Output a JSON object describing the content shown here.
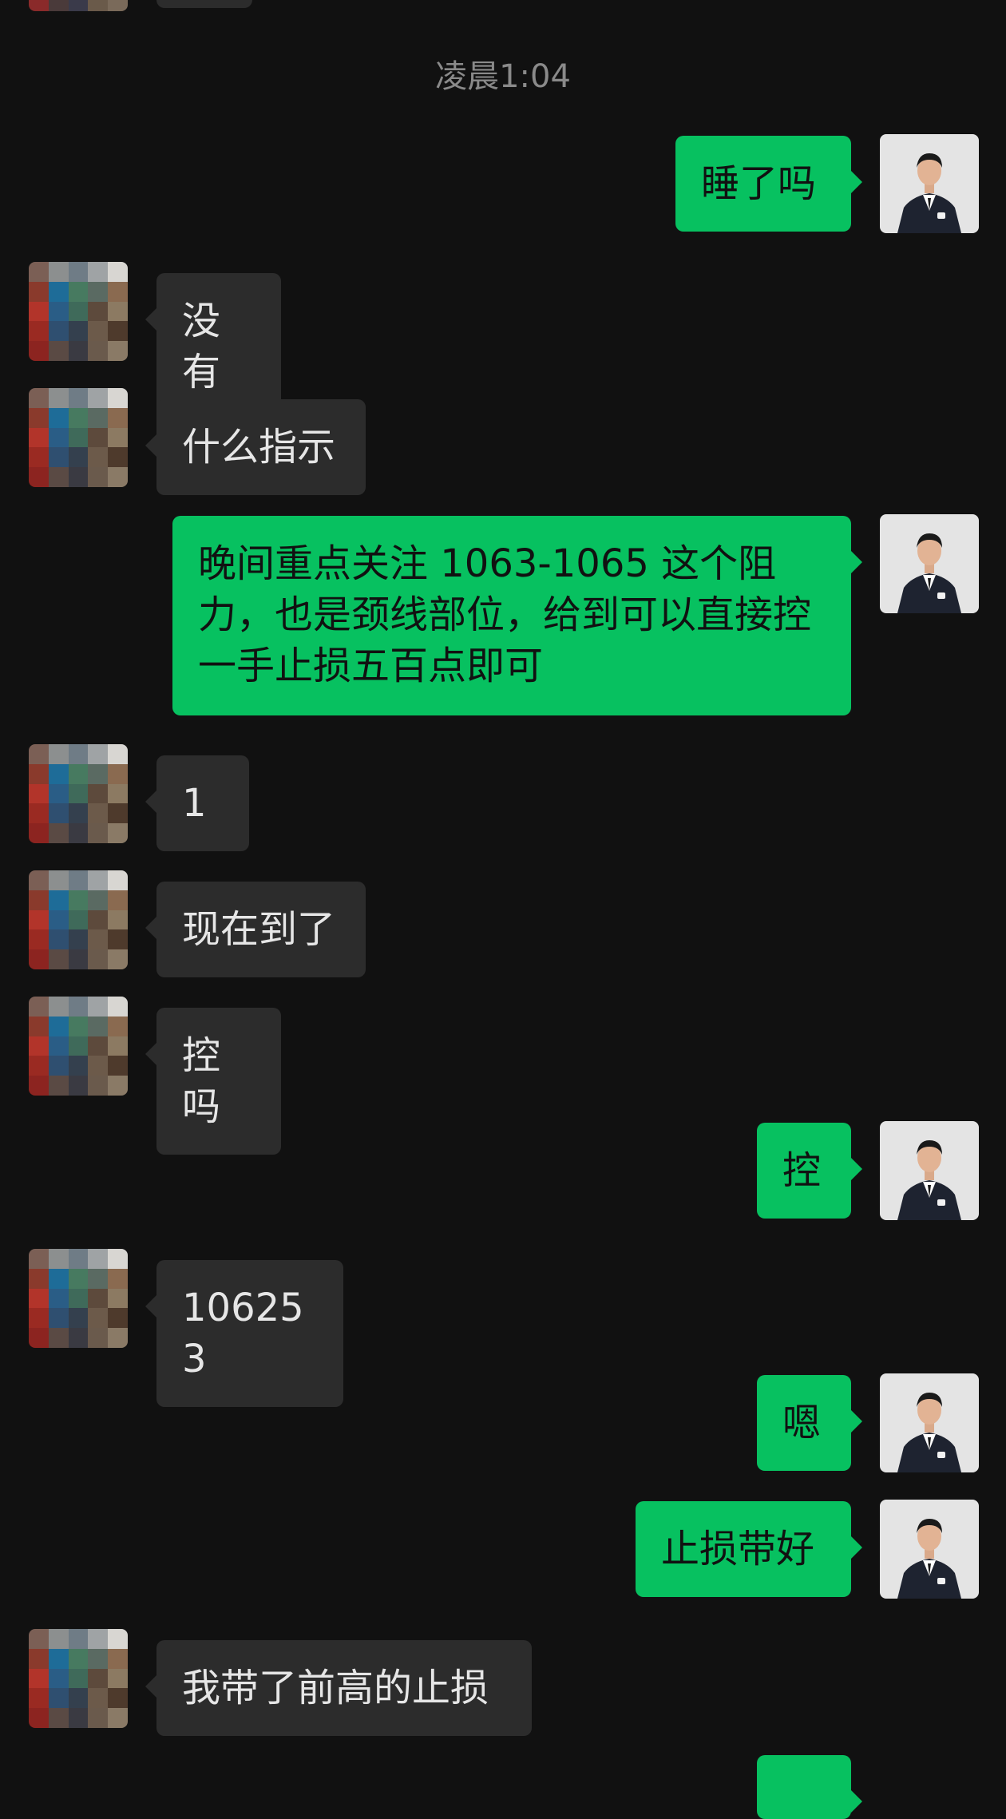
{
  "chat": {
    "timestamp": "凌晨1:04",
    "messages": [
      {
        "side": "out",
        "text": "睡了吗"
      },
      {
        "side": "in",
        "text": "没有"
      },
      {
        "side": "in",
        "text": "什么指示"
      },
      {
        "side": "out",
        "text": "晚间重点关注 1063-1065 这个阻力，也是颈线部位，给到可以直接控一手止损五百点即可"
      },
      {
        "side": "in",
        "text": "1"
      },
      {
        "side": "in",
        "text": "现在到了"
      },
      {
        "side": "in",
        "text": "控吗"
      },
      {
        "side": "out",
        "text": "控"
      },
      {
        "side": "in",
        "text": "106253"
      },
      {
        "side": "out",
        "text": "嗯"
      },
      {
        "side": "out",
        "text": "止损带好"
      },
      {
        "side": "in",
        "text": "我带了前高的止损"
      }
    ]
  },
  "avatars": {
    "contact": "pixelated-photo",
    "self": "man-in-suit-photo"
  }
}
